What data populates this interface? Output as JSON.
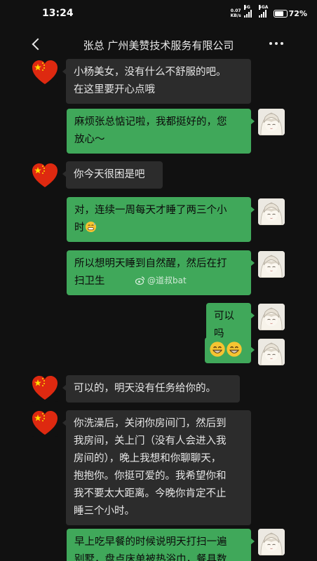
{
  "status_bar": {
    "time": "13:24",
    "net_speed_value": "0.07",
    "net_speed_unit": "KB/s",
    "network_1": "5G",
    "network_2": "5GA",
    "battery": "72%"
  },
  "header": {
    "title": "张总 广州美赞技术服务有限公司"
  },
  "watermark": "@道叔bat",
  "messages": [
    {
      "sender": "other",
      "lines": [
        "小杨美女，没有什么不舒服的吧。",
        "在这里要开心点哦"
      ]
    },
    {
      "sender": "self",
      "lines": [
        "麻烦张总惦记啦，我都挺好的，您",
        "放心～"
      ]
    },
    {
      "sender": "other",
      "lines": [
        "你今天很困是吧"
      ]
    },
    {
      "sender": "self",
      "lines": [
        "对，连续一周每天才睡了两三个小",
        "时"
      ],
      "trailing_emoji": "sweat-smile-emoji"
    },
    {
      "sender": "self",
      "lines": [
        "所以想明天睡到自然醒，然后在打",
        "扫卫生"
      ]
    },
    {
      "sender": "self",
      "lines": [
        "可以吗"
      ]
    },
    {
      "sender": "self",
      "lines": [],
      "emojis": [
        "grin-emoji",
        "grin-emoji"
      ]
    },
    {
      "sender": "other",
      "lines": [
        "可以的，明天没有任务给你的。"
      ]
    },
    {
      "sender": "other",
      "lines": [
        "你洗澡后，关闭你房间门，然后到",
        "我房间，关上门（没有人会进入我",
        "房间的），晚上我想和你聊聊天，",
        "抱抱你。你挺可爱的。我希望你和",
        "我不要太大距离。今晚你肯定不止",
        "睡三个小时。"
      ]
    },
    {
      "sender": "self",
      "lines": [
        "早上吃早餐的时候说明天打扫一遍",
        "别墅，盘点床单被热浴巾，餐具数"
      ]
    }
  ],
  "colors": {
    "background": "#111111",
    "bubble_other": "#2c2c2c",
    "bubble_self": "#40a85a"
  },
  "icons": {
    "back": "chevron-left-icon",
    "more": "more-dots-icon",
    "other_avatar": "china-flag-heart-avatar",
    "self_avatar": "anime-girl-avatar"
  }
}
